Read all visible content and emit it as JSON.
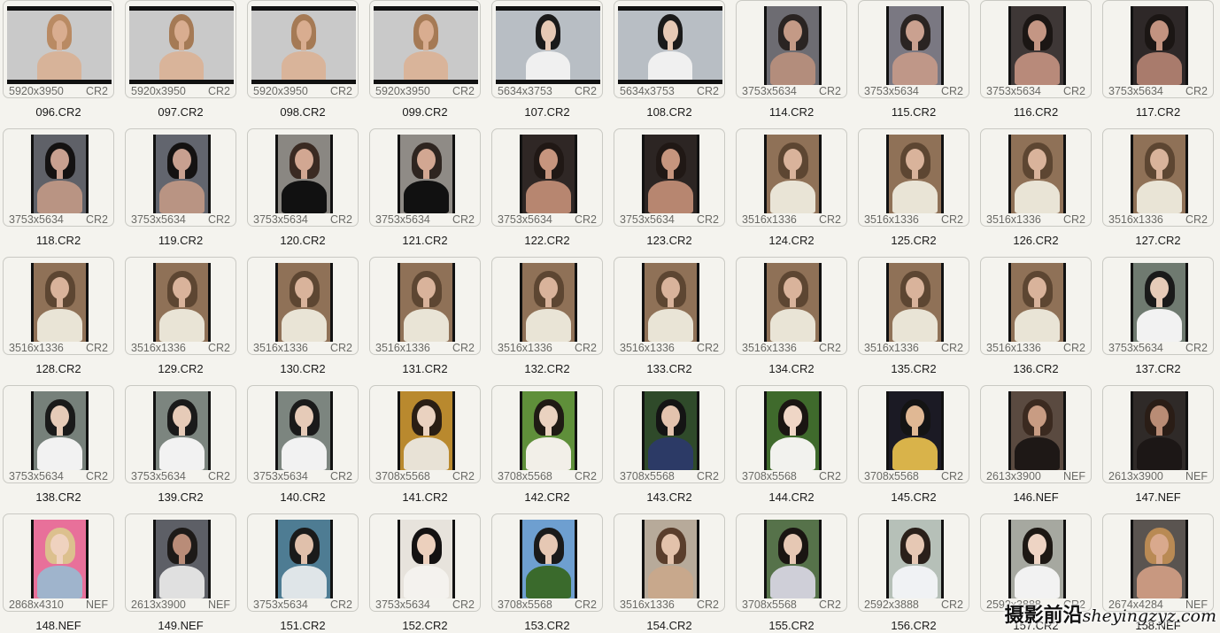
{
  "files": [
    {
      "name": "096.CR2",
      "dims": "5920x3950",
      "ext": "CR2",
      "orient": "land",
      "bg": "#c9c9c9",
      "skin": "#d9ad90",
      "top": "#b98a63",
      "outfit": "#d7b399"
    },
    {
      "name": "097.CR2",
      "dims": "5920x3950",
      "ext": "CR2",
      "orient": "land",
      "bg": "#c9c9c9",
      "skin": "#d9ad90",
      "top": "#a57a55",
      "outfit": "#d9b49a"
    },
    {
      "name": "098.CR2",
      "dims": "5920x3950",
      "ext": "CR2",
      "orient": "land",
      "bg": "#c9c9c9",
      "skin": "#d9ad90",
      "top": "#a57a55",
      "outfit": "#d9b49a"
    },
    {
      "name": "099.CR2",
      "dims": "5920x3950",
      "ext": "CR2",
      "orient": "land",
      "bg": "#c9c9c9",
      "skin": "#d9ad90",
      "top": "#a57a55",
      "outfit": "#d9b49a"
    },
    {
      "name": "107.CR2",
      "dims": "5634x3753",
      "ext": "CR2",
      "orient": "land",
      "bg": "#b8bec4",
      "skin": "#e6c9b5",
      "top": "#1a1a1a",
      "outfit": "#f0f0f0"
    },
    {
      "name": "108.CR2",
      "dims": "5634x3753",
      "ext": "CR2",
      "orient": "land",
      "bg": "#b8bec4",
      "skin": "#e6c9b5",
      "top": "#1a1a1a",
      "outfit": "#f0f0f0"
    },
    {
      "name": "114.CR2",
      "dims": "3753x5634",
      "ext": "CR2",
      "orient": "port",
      "bg": "#6d6c72",
      "skin": "#c49a86",
      "top": "#2a2422",
      "outfit": "#b38d7c"
    },
    {
      "name": "115.CR2",
      "dims": "3753x5634",
      "ext": "CR2",
      "orient": "port",
      "bg": "#7a7882",
      "skin": "#caa190",
      "top": "#2a2422",
      "outfit": "#bf9788"
    },
    {
      "name": "116.CR2",
      "dims": "3753x5634",
      "ext": "CR2",
      "orient": "port",
      "bg": "#3e3736",
      "skin": "#c49684",
      "top": "#1b1614",
      "outfit": "#b88a7a"
    },
    {
      "name": "117.CR2",
      "dims": "3753x5634",
      "ext": "CR2",
      "orient": "port",
      "bg": "#2e2828",
      "skin": "#c39380",
      "top": "#1b1614",
      "outfit": "#a97b6c"
    },
    {
      "name": "118.CR2",
      "dims": "3753x5634",
      "ext": "CR2",
      "orient": "port",
      "bg": "#5f6168",
      "skin": "#c8a090",
      "top": "#141212",
      "outfit": "#b99483"
    },
    {
      "name": "119.CR2",
      "dims": "3753x5634",
      "ext": "CR2",
      "orient": "port",
      "bg": "#62656e",
      "skin": "#c8a090",
      "top": "#141212",
      "outfit": "#b99483"
    },
    {
      "name": "120.CR2",
      "dims": "3753x5634",
      "ext": "CR2",
      "orient": "port",
      "bg": "#8a8782",
      "skin": "#d2a792",
      "top": "#3a2a22",
      "outfit": "#111111"
    },
    {
      "name": "121.CR2",
      "dims": "3753x5634",
      "ext": "CR2",
      "orient": "port",
      "bg": "#8f8b86",
      "skin": "#d2a792",
      "top": "#2e2520",
      "outfit": "#111111"
    },
    {
      "name": "122.CR2",
      "dims": "3753x5634",
      "ext": "CR2",
      "orient": "port",
      "bg": "#2f2725",
      "skin": "#c6957e",
      "top": "#201815",
      "outfit": "#b78670"
    },
    {
      "name": "123.CR2",
      "dims": "3753x5634",
      "ext": "CR2",
      "orient": "port",
      "bg": "#2c2523",
      "skin": "#c6957e",
      "top": "#201815",
      "outfit": "#b78670"
    },
    {
      "name": "124.CR2",
      "dims": "3516x1336",
      "ext": "CR2",
      "orient": "port",
      "bg": "#8f7157",
      "skin": "#d9b39b",
      "top": "#5d4632",
      "outfit": "#e9e4d6"
    },
    {
      "name": "125.CR2",
      "dims": "3516x1336",
      "ext": "CR2",
      "orient": "port",
      "bg": "#8f7157",
      "skin": "#d9b39b",
      "top": "#5d4632",
      "outfit": "#e9e4d6"
    },
    {
      "name": "126.CR2",
      "dims": "3516x1336",
      "ext": "CR2",
      "orient": "port",
      "bg": "#8f7157",
      "skin": "#d9b39b",
      "top": "#5d4632",
      "outfit": "#e9e4d6"
    },
    {
      "name": "127.CR2",
      "dims": "3516x1336",
      "ext": "CR2",
      "orient": "port",
      "bg": "#8f7157",
      "skin": "#d9b39b",
      "top": "#5d4632",
      "outfit": "#e9e4d6"
    },
    {
      "name": "128.CR2",
      "dims": "3516x1336",
      "ext": "CR2",
      "orient": "port",
      "bg": "#8f7157",
      "skin": "#d9b39b",
      "top": "#5d4632",
      "outfit": "#e9e4d6"
    },
    {
      "name": "129.CR2",
      "dims": "3516x1336",
      "ext": "CR2",
      "orient": "port",
      "bg": "#8f7157",
      "skin": "#d9b39b",
      "top": "#5d4632",
      "outfit": "#e9e4d6"
    },
    {
      "name": "130.CR2",
      "dims": "3516x1336",
      "ext": "CR2",
      "orient": "port",
      "bg": "#8f7157",
      "skin": "#d9b39b",
      "top": "#5d4632",
      "outfit": "#e9e4d6"
    },
    {
      "name": "131.CR2",
      "dims": "3516x1336",
      "ext": "CR2",
      "orient": "port",
      "bg": "#8f7157",
      "skin": "#d9b39b",
      "top": "#5d4632",
      "outfit": "#e9e4d6"
    },
    {
      "name": "132.CR2",
      "dims": "3516x1336",
      "ext": "CR2",
      "orient": "port",
      "bg": "#8f7157",
      "skin": "#d9b39b",
      "top": "#5d4632",
      "outfit": "#e9e4d6"
    },
    {
      "name": "133.CR2",
      "dims": "3516x1336",
      "ext": "CR2",
      "orient": "port",
      "bg": "#8f7157",
      "skin": "#d9b39b",
      "top": "#5d4632",
      "outfit": "#e9e4d6"
    },
    {
      "name": "134.CR2",
      "dims": "3516x1336",
      "ext": "CR2",
      "orient": "port",
      "bg": "#8f7157",
      "skin": "#d9b39b",
      "top": "#5d4632",
      "outfit": "#e9e4d6"
    },
    {
      "name": "135.CR2",
      "dims": "3516x1336",
      "ext": "CR2",
      "orient": "port",
      "bg": "#8f7157",
      "skin": "#d9b39b",
      "top": "#5d4632",
      "outfit": "#e9e4d6"
    },
    {
      "name": "136.CR2",
      "dims": "3516x1336",
      "ext": "CR2",
      "orient": "port",
      "bg": "#8f7157",
      "skin": "#d9b39b",
      "top": "#5d4632",
      "outfit": "#e9e4d6"
    },
    {
      "name": "137.CR2",
      "dims": "3753x5634",
      "ext": "CR2",
      "orient": "port",
      "bg": "#6f7a70",
      "skin": "#e6cbb8",
      "top": "#1a1a1a",
      "outfit": "#f2f2f2"
    },
    {
      "name": "138.CR2",
      "dims": "3753x5634",
      "ext": "CR2",
      "orient": "port",
      "bg": "#76807a",
      "skin": "#e6cbb8",
      "top": "#1a1a1a",
      "outfit": "#f2f2f2"
    },
    {
      "name": "139.CR2",
      "dims": "3753x5634",
      "ext": "CR2",
      "orient": "port",
      "bg": "#7c857f",
      "skin": "#e6cbb8",
      "top": "#1a1a1a",
      "outfit": "#f2f2f2"
    },
    {
      "name": "140.CR2",
      "dims": "3753x5634",
      "ext": "CR2",
      "orient": "port",
      "bg": "#7c857f",
      "skin": "#e6cbb8",
      "top": "#1a1a1a",
      "outfit": "#f2f2f2"
    },
    {
      "name": "141.CR2",
      "dims": "3708x5568",
      "ext": "CR2",
      "orient": "port",
      "bg": "#b9892e",
      "skin": "#ead2c0",
      "top": "#2a1e14",
      "outfit": "#e8e2d6"
    },
    {
      "name": "142.CR2",
      "dims": "3708x5568",
      "ext": "CR2",
      "orient": "port",
      "bg": "#5f8f3a",
      "skin": "#ead2c0",
      "top": "#1f1a14",
      "outfit": "#f2efe8"
    },
    {
      "name": "143.CR2",
      "dims": "3708x5568",
      "ext": "CR2",
      "orient": "port",
      "bg": "#2f4a2a",
      "skin": "#e3c3ae",
      "top": "#141414",
      "outfit": "#2c3a66"
    },
    {
      "name": "144.CR2",
      "dims": "3708x5568",
      "ext": "CR2",
      "orient": "port",
      "bg": "#3f6a2c",
      "skin": "#efd6c6",
      "top": "#1a1512",
      "outfit": "#f2f2ee"
    },
    {
      "name": "145.CR2",
      "dims": "3708x5568",
      "ext": "CR2",
      "orient": "port",
      "bg": "#1b1a24",
      "skin": "#e0b894",
      "top": "#141414",
      "outfit": "#d9b34a"
    },
    {
      "name": "146.NEF",
      "dims": "2613x3900",
      "ext": "NEF",
      "orient": "port",
      "bg": "#5a4a40",
      "skin": "#c89c83",
      "top": "#3b2a20",
      "outfit": "#1e1816"
    },
    {
      "name": "147.NEF",
      "dims": "2613x3900",
      "ext": "NEF",
      "orient": "port",
      "bg": "#2f2a28",
      "skin": "#b98c75",
      "top": "#2a1d16",
      "outfit": "#1c1716"
    },
    {
      "name": "148.NEF",
      "dims": "2868x4310",
      "ext": "NEF",
      "orient": "port",
      "bg": "#e8709a",
      "skin": "#efd2bf",
      "top": "#dcc08e",
      "outfit": "#9fb4cc"
    },
    {
      "name": "149.NEF",
      "dims": "2613x3900",
      "ext": "NEF",
      "orient": "port",
      "bg": "#5d5f66",
      "skin": "#b98c78",
      "top": "#1d1a18",
      "outfit": "#e0e0e0"
    },
    {
      "name": "151.CR2",
      "dims": "3753x5634",
      "ext": "CR2",
      "orient": "port",
      "bg": "#4e7c93",
      "skin": "#e0c0ab",
      "top": "#1a1a1a",
      "outfit": "#dfe5e8"
    },
    {
      "name": "152.CR2",
      "dims": "3753x5634",
      "ext": "CR2",
      "orient": "port",
      "bg": "#e7e3dc",
      "skin": "#ecd0bd",
      "top": "#141212",
      "outfit": "#f4f2ee"
    },
    {
      "name": "153.CR2",
      "dims": "3708x5568",
      "ext": "CR2",
      "orient": "port",
      "bg": "#6e9fd0",
      "skin": "#e6c8b4",
      "top": "#1a1a1a",
      "outfit": "#3a6a2c"
    },
    {
      "name": "154.CR2",
      "dims": "3516x1336",
      "ext": "CR2",
      "orient": "port",
      "bg": "#b7aa9a",
      "skin": "#e3c2ab",
      "top": "#5a3e2c",
      "outfit": "#c8a88c"
    },
    {
      "name": "155.CR2",
      "dims": "3708x5568",
      "ext": "CR2",
      "orient": "port",
      "bg": "#56724a",
      "skin": "#e6c8b4",
      "top": "#1a1512",
      "outfit": "#cfcfd8"
    },
    {
      "name": "156.CR2",
      "dims": "2592x3888",
      "ext": "CR2",
      "orient": "port",
      "bg": "#b6c0b8",
      "skin": "#e6c8b4",
      "top": "#2a201a",
      "outfit": "#f0f2f4"
    },
    {
      "name": "157.CR2",
      "dims": "2592x3888",
      "ext": "CR2",
      "orient": "port",
      "bg": "#a6a8a0",
      "skin": "#eed4c4",
      "top": "#1d1814",
      "outfit": "#f2f2f2"
    },
    {
      "name": "158.NEF",
      "dims": "2674x4284",
      "ext": "NEF",
      "orient": "port",
      "bg": "#5a5450",
      "skin": "#d9a98d",
      "top": "#b98a54",
      "outfit": "#c89880"
    }
  ],
  "watermark": {
    "cn": "摄影前沿",
    "latin": "sheyingzyz.com"
  }
}
